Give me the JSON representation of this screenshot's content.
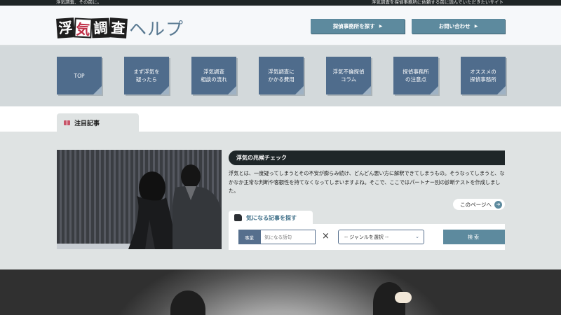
{
  "topbar": {
    "left_text": "浮気調査、その前に。",
    "right_text": "浮気調査を探偵事務所に依頼する前に読んでいただきたいサイト"
  },
  "logo": {
    "boxed_chars": [
      "浮",
      "気",
      "調",
      "査"
    ],
    "tail_text": "ヘルプ"
  },
  "header": {
    "buttons": [
      {
        "label": "探偵事務所を探す",
        "icon": "triangle-right-icon"
      },
      {
        "label": "お問い合わせ",
        "icon": "triangle-right-icon"
      }
    ]
  },
  "nav": {
    "items": [
      {
        "label": "TOP"
      },
      {
        "label": "まず浮気を\n疑ったら"
      },
      {
        "label": "浮気調査\n相談の流れ"
      },
      {
        "label": "浮気調査に\nかかる費用"
      },
      {
        "label": "浮気不倫探偵\nコラム"
      },
      {
        "label": "探偵事務所\nの注意点"
      },
      {
        "label": "オススメの\n探偵事務所"
      }
    ]
  },
  "featured": {
    "tab_label": "注目記事",
    "tab_icon": "book-icon",
    "article": {
      "title": "浮気の兆候チェック",
      "body": "浮気とは、一度疑ってしまうとその不安が膨らみ続け、どんどん悪い方に解釈できてしまうもの。そうなってしまうと、なかなか正常な判断や客観性を持てなくなってしまいますよね。そこで、ここではパートナー別の診断テストを作成しました。",
      "more_label": "このページへ",
      "more_icon": "arrow-right-circle-icon"
    }
  },
  "search": {
    "tab_label": "気になる記事を探す",
    "tab_icon": "thumbs-up-icon",
    "keyword_label": "事業",
    "keyword_placeholder": "気になる語句",
    "times_symbol": "×",
    "genre_selected": "-- ジャンルを選択 --",
    "submit_label": "検索"
  },
  "colors": {
    "accent": "#5d8a9e",
    "nav_tile": "#4f6c8c",
    "dark": "#1e2628",
    "page_bg": "#dfe3e3"
  }
}
